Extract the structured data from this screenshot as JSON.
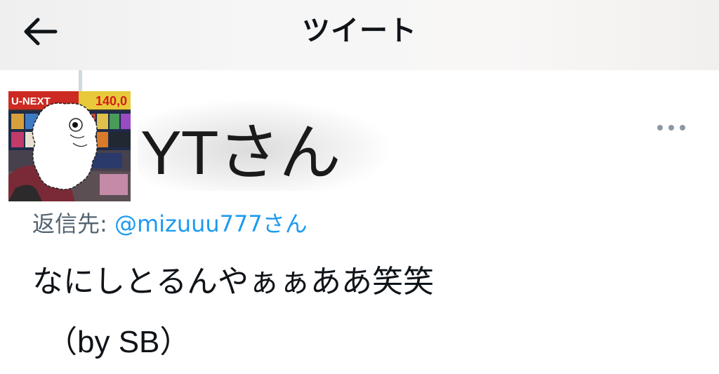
{
  "header": {
    "title": "ツイート",
    "back_icon": "arrow-left-icon"
  },
  "tweet": {
    "display_name": "YTさん",
    "more_icon": "more-horizontal-icon",
    "avatar_banner_text": "U-NEXT",
    "avatar_price_text": "140,0",
    "reply": {
      "label": "返信先: ",
      "mention": "@mizuuu777さん"
    },
    "text_line1": "なにしとるんやぁぁああ笑笑",
    "text_line2": "（by SB）"
  },
  "colors": {
    "text_primary": "#0f1419",
    "text_secondary": "#536471",
    "link": "#1d9bf0",
    "thread_line": "#cfd9de"
  }
}
